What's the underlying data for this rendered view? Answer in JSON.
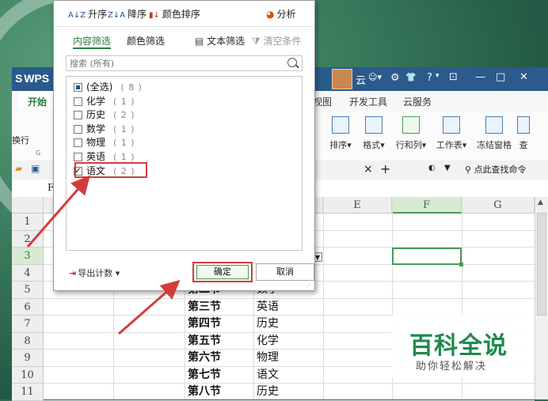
{
  "window": {
    "app_title": "WPS",
    "user_name": "云",
    "controls": {
      "minimize": "—",
      "maximize": "□",
      "close": "✕"
    },
    "toolbar_glyphs": {
      "settings": "⚙",
      "shirt": "👕",
      "help": "?",
      "box": "⊡"
    }
  },
  "ribbon_tabs": [
    "开始",
    "视图",
    "开发工具",
    "云服务"
  ],
  "ribbon_buttons": [
    {
      "label": "排序",
      "icon": "sort-icon",
      "caret": "▾"
    },
    {
      "label": "格式",
      "icon": "format-icon",
      "caret": "▾"
    },
    {
      "label": "行和列",
      "icon": "rows-cols-icon",
      "caret": "▾"
    },
    {
      "label": "工作表",
      "icon": "worksheet-icon",
      "caret": "▾"
    },
    {
      "label": "冻结窗格",
      "icon": "freeze-panes-icon"
    },
    {
      "label": "查",
      "icon": "find-icon"
    }
  ],
  "ribbon_left_label": "换行",
  "ribbon_left_small": "G",
  "doc_tab_bar": {
    "close": "×",
    "add": "+",
    "search_hint": "点此查找命令"
  },
  "formula_bar": {
    "name_prefix": "F"
  },
  "sheet": {
    "columns": [
      "E",
      "F",
      "G"
    ],
    "selected_column": "F",
    "row_numbers": [
      "1",
      "2",
      "3",
      "4",
      "5",
      "6",
      "7",
      "8",
      "9",
      "10",
      "11"
    ],
    "selected_row": "3",
    "dropdown_arrow": "▼",
    "col_c": [
      "",
      "",
      "",
      "",
      "第二节",
      "第三节",
      "第四节",
      "第五节",
      "第六节",
      "第七节",
      "第八节"
    ],
    "col_d": [
      "",
      "",
      "",
      "",
      "数学",
      "英语",
      "历史",
      "化学",
      "物理",
      "语文",
      "历史"
    ]
  },
  "filter_popup": {
    "sort_ascending": "升序",
    "sort_descending": "降序",
    "sort_by_color": "颜色排序",
    "analyze": "分析",
    "tab_content": "内容筛选",
    "tab_color": "颜色筛选",
    "text_filter": "文本筛选",
    "clear_condition": "清空条件",
    "search_placeholder": "搜索 (所有)",
    "items": [
      {
        "label": "(全选)",
        "count": "( 8 )",
        "state": "partial"
      },
      {
        "label": "化学",
        "count": "( 1 )",
        "state": "unchecked"
      },
      {
        "label": "历史",
        "count": "( 2 )",
        "state": "unchecked"
      },
      {
        "label": "数学",
        "count": "( 1 )",
        "state": "unchecked"
      },
      {
        "label": "物理",
        "count": "( 1 )",
        "state": "unchecked"
      },
      {
        "label": "英语",
        "count": "( 1 )",
        "state": "unchecked"
      },
      {
        "label": "语文",
        "count": "( 2 )",
        "state": "checked"
      }
    ],
    "check_mark": "✓",
    "export_count": "导出计数",
    "export_caret": "▾",
    "ok": "确定",
    "cancel": "取消"
  },
  "watermark": {
    "title": "百科全说",
    "subtitle": "助你轻松解决"
  },
  "colors": {
    "accent_green": "#2b7a3f",
    "highlight_red": "#d43c3c",
    "title_blue": "#2b5a8c"
  }
}
